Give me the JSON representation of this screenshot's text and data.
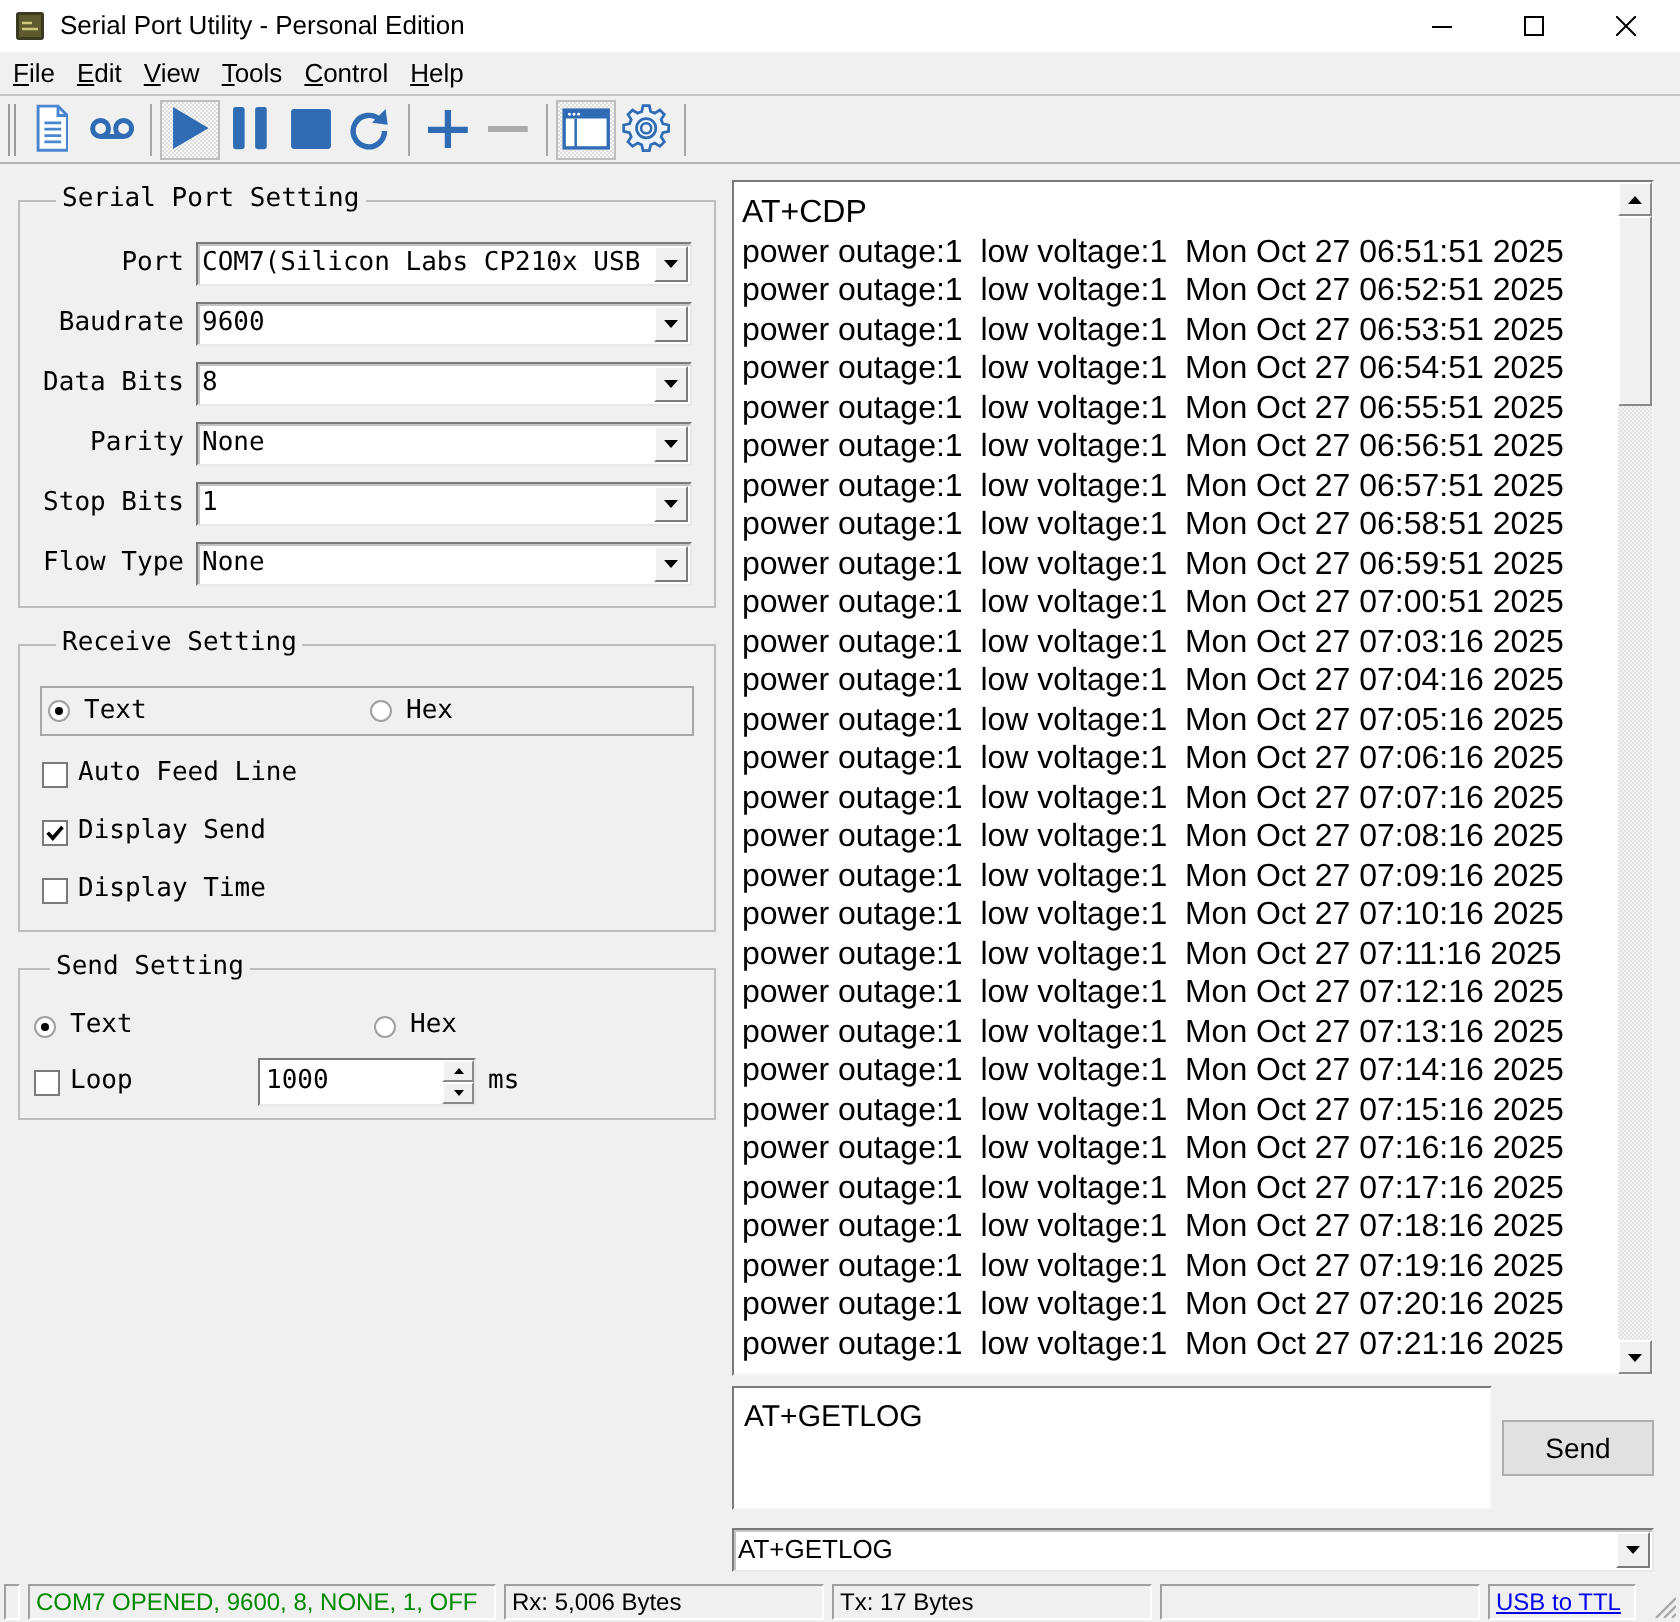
{
  "window": {
    "title": "Serial Port Utility - Personal Edition"
  },
  "menu": [
    "File",
    "Edit",
    "View",
    "Tools",
    "Control",
    "Help"
  ],
  "toolbar": {
    "groups": [
      [
        {
          "pressed": false,
          "disabled": false
        },
        {
          "pressed": false,
          "disabled": false
        }
      ],
      [
        {
          "pressed": true,
          "disabled": false
        },
        {
          "pressed": false,
          "disabled": false
        },
        {
          "pressed": false,
          "disabled": false
        },
        {
          "pressed": false,
          "disabled": false
        }
      ],
      [
        {
          "pressed": false,
          "disabled": false
        },
        {
          "pressed": false,
          "disabled": true
        }
      ],
      [
        {
          "pressed": true,
          "disabled": false
        },
        {
          "pressed": false,
          "disabled": false
        }
      ]
    ]
  },
  "serial_port_setting": {
    "title": "Serial Port Setting",
    "fields": [
      {
        "label": "Port",
        "value": "COM7(Silicon Labs CP210x USB"
      },
      {
        "label": "Baudrate",
        "value": "9600"
      },
      {
        "label": "Data Bits",
        "value": "8"
      },
      {
        "label": "Parity",
        "value": "None"
      },
      {
        "label": "Stop Bits",
        "value": "1"
      },
      {
        "label": "Flow Type",
        "value": "None"
      }
    ]
  },
  "receive_setting": {
    "title": "Receive Setting",
    "modes": [
      {
        "label": "Text",
        "selected": true
      },
      {
        "label": "Hex",
        "selected": false
      }
    ],
    "options": [
      {
        "label": "Auto Feed Line",
        "checked": false
      },
      {
        "label": "Display Send",
        "checked": true
      },
      {
        "label": "Display Time",
        "checked": false
      }
    ]
  },
  "send_setting": {
    "title": "Send Setting",
    "modes": [
      {
        "label": "Text",
        "selected": true
      },
      {
        "label": "Hex",
        "selected": false
      }
    ],
    "loop": {
      "label": "Loop",
      "checked": false,
      "interval": "1000",
      "unit": "ms"
    }
  },
  "receive_log": {
    "lines": [
      "AT+CDP",
      "power outage:1  low voltage:1  Mon Oct 27 06:51:51 2025",
      "power outage:1  low voltage:1  Mon Oct 27 06:52:51 2025",
      "power outage:1  low voltage:1  Mon Oct 27 06:53:51 2025",
      "power outage:1  low voltage:1  Mon Oct 27 06:54:51 2025",
      "power outage:1  low voltage:1  Mon Oct 27 06:55:51 2025",
      "power outage:1  low voltage:1  Mon Oct 27 06:56:51 2025",
      "power outage:1  low voltage:1  Mon Oct 27 06:57:51 2025",
      "power outage:1  low voltage:1  Mon Oct 27 06:58:51 2025",
      "power outage:1  low voltage:1  Mon Oct 27 06:59:51 2025",
      "power outage:1  low voltage:1  Mon Oct 27 07:00:51 2025",
      "power outage:1  low voltage:1  Mon Oct 27 07:03:16 2025",
      "power outage:1  low voltage:1  Mon Oct 27 07:04:16 2025",
      "power outage:1  low voltage:1  Mon Oct 27 07:05:16 2025",
      "power outage:1  low voltage:1  Mon Oct 27 07:06:16 2025",
      "power outage:1  low voltage:1  Mon Oct 27 07:07:16 2025",
      "power outage:1  low voltage:1  Mon Oct 27 07:08:16 2025",
      "power outage:1  low voltage:1  Mon Oct 27 07:09:16 2025",
      "power outage:1  low voltage:1  Mon Oct 27 07:10:16 2025",
      "power outage:1  low voltage:1  Mon Oct 27 07:11:16 2025",
      "power outage:1  low voltage:1  Mon Oct 27 07:12:16 2025",
      "power outage:1  low voltage:1  Mon Oct 27 07:13:16 2025",
      "power outage:1  low voltage:1  Mon Oct 27 07:14:16 2025",
      "power outage:1  low voltage:1  Mon Oct 27 07:15:16 2025",
      "power outage:1  low voltage:1  Mon Oct 27 07:16:16 2025",
      "power outage:1  low voltage:1  Mon Oct 27 07:17:16 2025",
      "power outage:1  low voltage:1  Mon Oct 27 07:18:16 2025",
      "power outage:1  low voltage:1  Mon Oct 27 07:19:16 2025",
      "power outage:1  low voltage:1  Mon Oct 27 07:20:16 2025",
      "power outage:1  low voltage:1  Mon Oct 27 07:21:16 2025"
    ]
  },
  "send_panel": {
    "input": "AT+GETLOG",
    "button": "Send",
    "history": "AT+GETLOG"
  },
  "status_bar": {
    "connection": {
      "text": "COM7 OPENED, 9600, 8, NONE, 1, OFF",
      "open": true
    },
    "rx": "Rx: 5,006 Bytes",
    "tx": "Tx: 17 Bytes",
    "link": "USB to TTL"
  }
}
